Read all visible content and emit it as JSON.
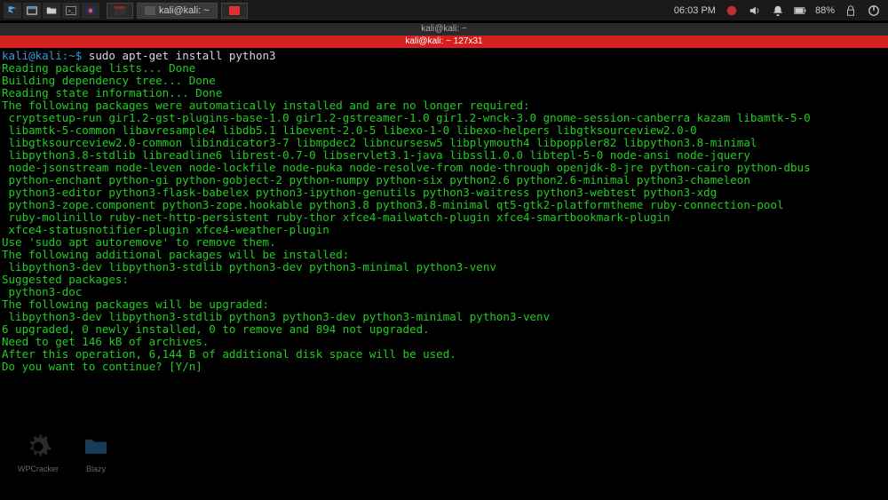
{
  "panel": {
    "task1_label": "",
    "task2_label": "kali@kali: ~",
    "task3_label": "",
    "clock": "06:03 PM",
    "battery": "88%"
  },
  "terminal": {
    "title": "kali@kali: ~",
    "tab": "kali@kali: ~  127x31",
    "prompt_user": "kali@kali",
    "prompt_path": ":~$",
    "command": " sudo apt-get install python3",
    "l1": "Reading package lists... Done",
    "l2": "Building dependency tree... Done",
    "l3": "Reading state information... Done",
    "l4": "The following packages were automatically installed and are no longer required:",
    "pkg1": "cryptsetup-run gir1.2-gst-plugins-base-1.0 gir1.2-gstreamer-1.0 gir1.2-wnck-3.0 gnome-session-canberra kazam libamtk-5-0",
    "pkg2": "libamtk-5-common libavresample4 libdb5.1 libevent-2.0-5 libexo-1-0 libexo-helpers libgtksourceview2.0-0",
    "pkg3": "libgtksourceview2.0-common libindicator3-7 libmpdec2 libncursesw5 libplymouth4 libpoppler82 libpython3.8-minimal",
    "pkg4": "libpython3.8-stdlib libreadline6 librest-0.7-0 libservlet3.1-java libssl1.0.0 libtepl-5-0 node-ansi node-jquery",
    "pkg5": "node-jsonstream node-leven node-lockfile node-puka node-resolve-from node-through openjdk-8-jre python-cairo python-dbus",
    "pkg6": "python-enchant python-gi python-gobject-2 python-numpy python-six python2.6 python2.6-minimal python3-chameleon",
    "pkg7": "python3-editor python3-flask-babelex python3-ipython-genutils python3-waitress python3-webtest python3-xdg",
    "pkg8": "python3-zope.component python3-zope.hookable python3.8 python3.8-minimal qt5-gtk2-platformtheme ruby-connection-pool",
    "pkg9": "ruby-molinillo ruby-net-http-persistent ruby-thor xfce4-mailwatch-plugin xfce4-smartbookmark-plugin",
    "pkg10": "xfce4-statusnotifier-plugin xfce4-weather-plugin",
    "l5": "Use 'sudo apt autoremove' to remove them.",
    "l6": "The following additional packages will be installed:",
    "add1": "libpython3-dev libpython3-stdlib python3-dev python3-minimal python3-venv",
    "l7": "Suggested packages:",
    "sug1": "python3-doc",
    "l8": "The following packages will be upgraded:",
    "upg1": "libpython3-dev libpython3-stdlib python3 python3-dev python3-minimal python3-venv",
    "l9": "6 upgraded, 0 newly installed, 0 to remove and 894 not upgraded.",
    "l10": "Need to get 146 kB of archives.",
    "l11": "After this operation, 6,144 B of additional disk space will be used.",
    "l12": "Do you want to continue? [Y/n]"
  },
  "desktop": {
    "item1": "WPCracker",
    "item2": "Blazy"
  }
}
